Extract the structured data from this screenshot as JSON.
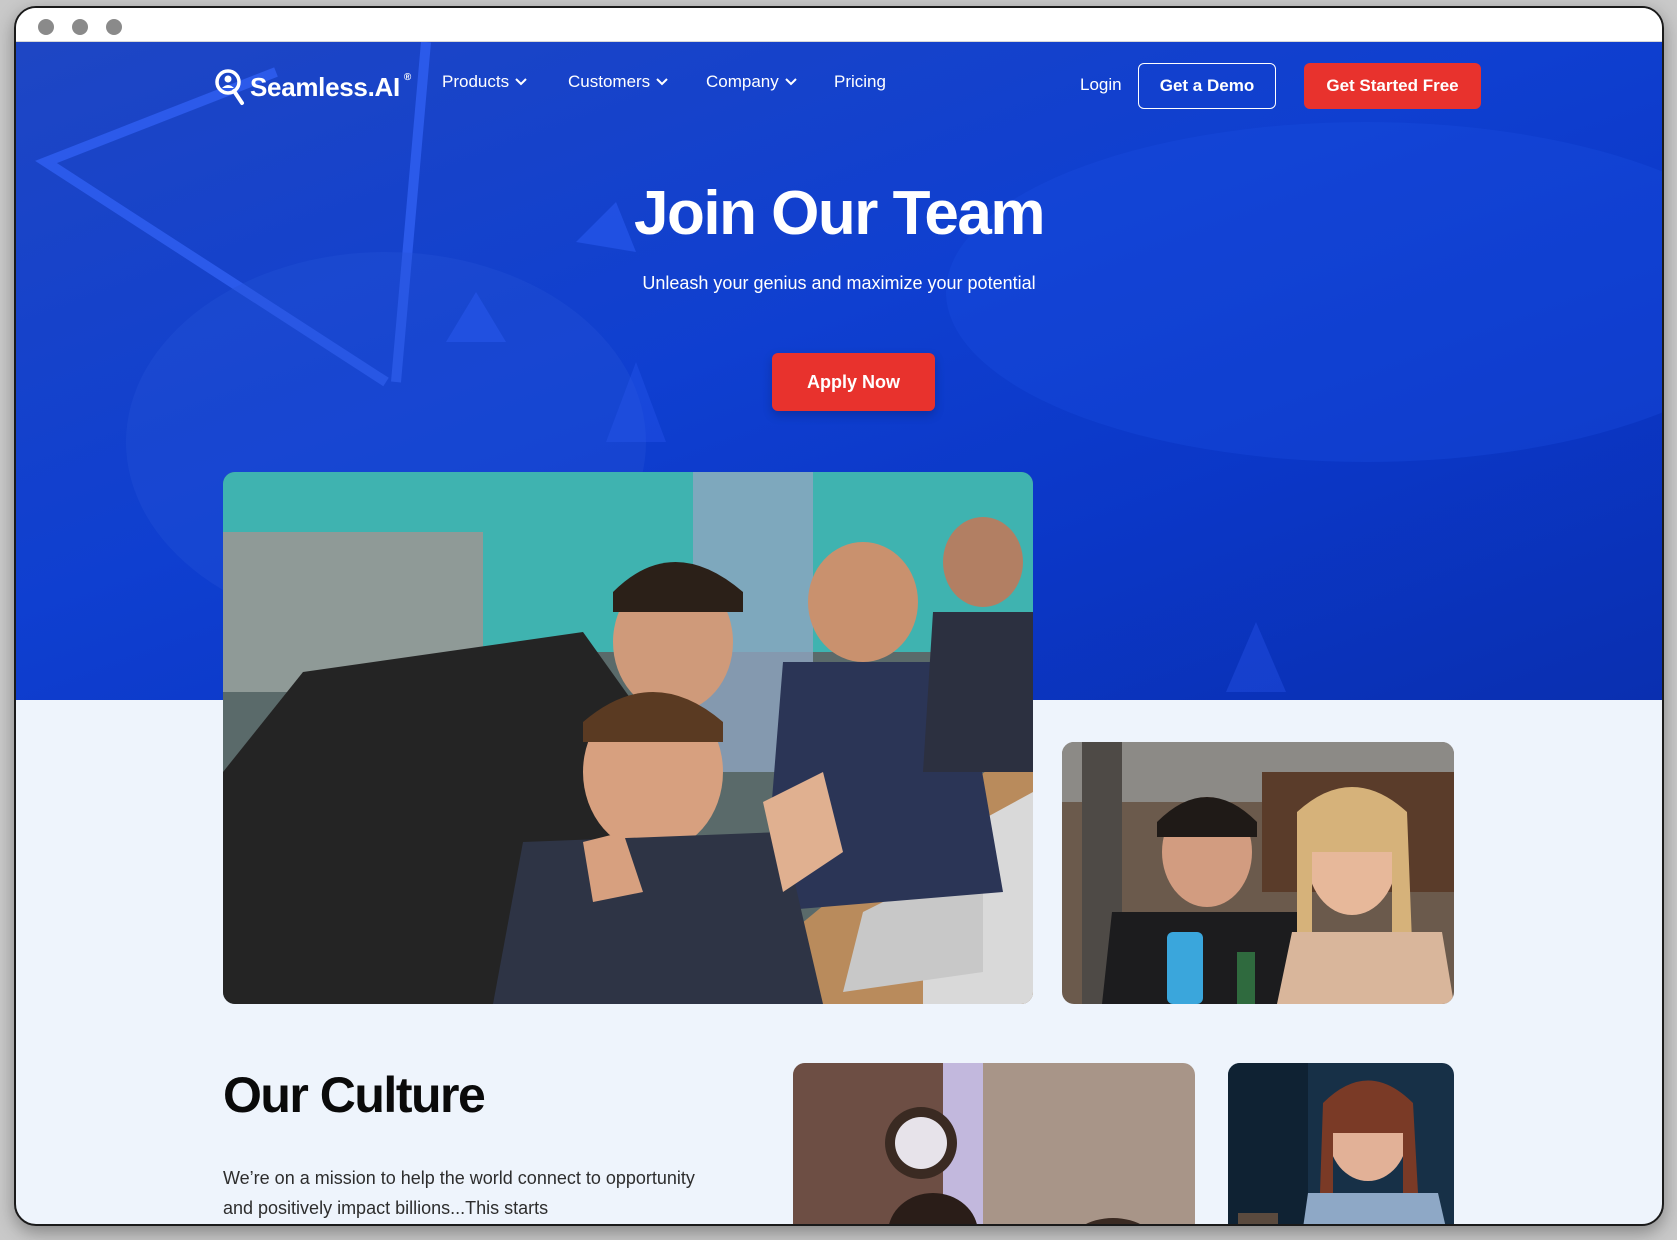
{
  "brand": {
    "name": "Seamless.AI",
    "mark": "®"
  },
  "nav": {
    "items": [
      {
        "label": "Products",
        "has_menu": true
      },
      {
        "label": "Customers",
        "has_menu": true
      },
      {
        "label": "Company",
        "has_menu": true
      },
      {
        "label": "Pricing",
        "has_menu": false
      }
    ],
    "login": "Login",
    "demo": "Get a Demo",
    "cta": "Get Started Free"
  },
  "hero": {
    "title": "Join Our Team",
    "subtitle": "Unleash your genius and maximize your potential",
    "apply": "Apply Now"
  },
  "culture": {
    "title": "Our Culture",
    "text": "We’re on a mission to help the world connect to opportunity and positively impact billions...This starts"
  },
  "colors": {
    "hero_blue": "#0f3fd0",
    "cta_red": "#e8322d",
    "page_bg": "#eef4fc"
  },
  "photos": [
    {
      "name": "team-celebrating-photo"
    },
    {
      "name": "two-colleagues-laughing-photo"
    },
    {
      "name": "office-group-photo"
    },
    {
      "name": "woman-smiling-photo"
    }
  ]
}
